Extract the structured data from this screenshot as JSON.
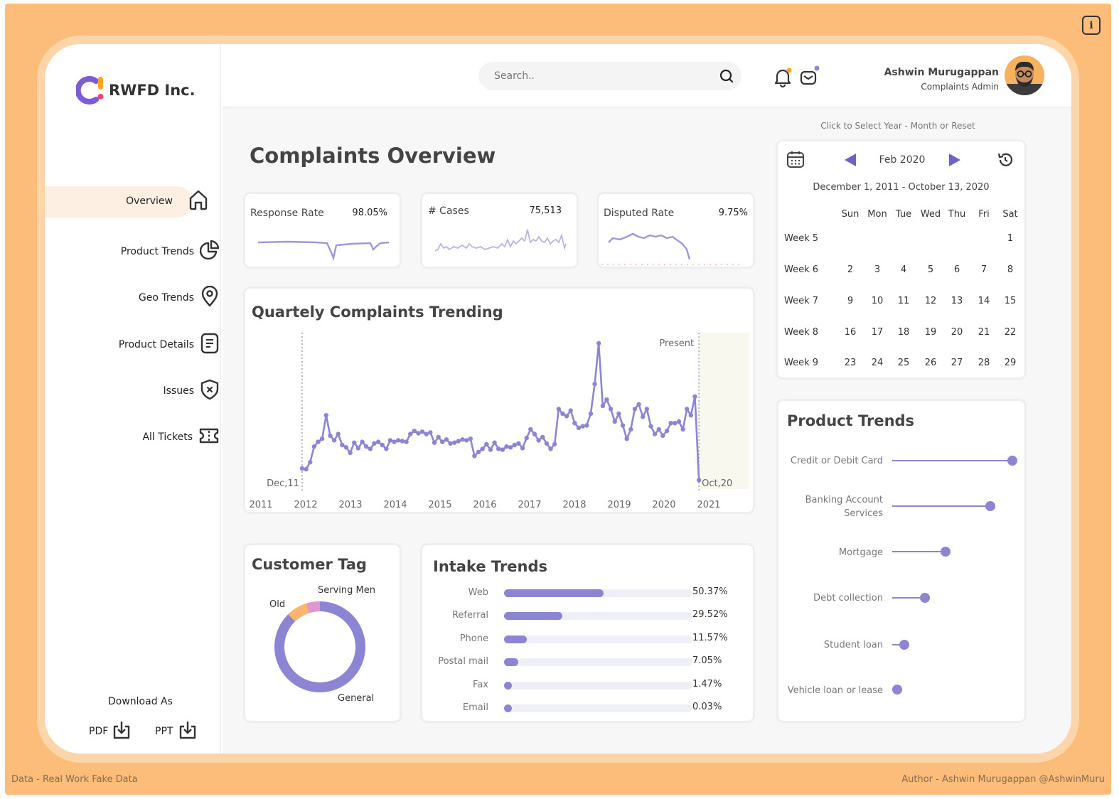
{
  "app": {
    "brand": "RWFD Inc.",
    "info_icon": "info-icon",
    "footer_left": "Data - Real Work Fake Data",
    "footer_right": "Author - Ashwin Murugappan @AshwinMuru"
  },
  "colors": {
    "page_bg": "#fcbd7b",
    "accent": "#8b85d4",
    "accent_dark": "#6c62c9",
    "active_nav": "#fdf0e3"
  },
  "sidebar": {
    "items": [
      {
        "label": "Overview",
        "icon": "home-icon"
      },
      {
        "label": "Product Trends",
        "icon": "pie-chart-icon"
      },
      {
        "label": "Geo Trends",
        "icon": "map-pin-icon"
      },
      {
        "label": "Product Details",
        "icon": "document-icon"
      },
      {
        "label": "Issues",
        "icon": "shield-x-icon"
      },
      {
        "label": "All Tickets",
        "icon": "ticket-icon"
      }
    ],
    "download_label": "Download As",
    "pdf_label": "PDF",
    "ppt_label": "PPT"
  },
  "header": {
    "search_placeholder": "Search..",
    "user_name": "Ashwin Murugappan",
    "user_role": "Complaints Admin"
  },
  "main": {
    "title": "Complaints Overview",
    "kpis": [
      {
        "label": "Response Rate",
        "value": "98.05%"
      },
      {
        "label": "# Cases",
        "value": "75,513"
      },
      {
        "label": "Disputed Rate",
        "value": "9.75%"
      }
    ],
    "customer_tag": {
      "title": "Customer Tag",
      "labels": {
        "old": "Old",
        "serving": "Serving Men",
        "general": "General"
      }
    },
    "intake": {
      "title": "Intake Trends",
      "rows": [
        {
          "label": "Web",
          "value": 50.37,
          "display": "50.37%"
        },
        {
          "label": "Referral",
          "value": 29.52,
          "display": "29.52%"
        },
        {
          "label": "Phone",
          "value": 11.57,
          "display": "11.57%"
        },
        {
          "label": "Postal mail",
          "value": 7.05,
          "display": "7.05%"
        },
        {
          "label": "Fax",
          "value": 1.47,
          "display": "1.47%"
        },
        {
          "label": "Email",
          "value": 0.03,
          "display": "0.03%"
        }
      ]
    }
  },
  "calendar": {
    "hint": "Click to Select Year - Month or Reset",
    "month": "Feb 2020",
    "range": "December 1, 2011 - October 13, 2020",
    "days": [
      "Sun",
      "Mon",
      "Tue",
      "Wed",
      "Thu",
      "Fri",
      "Sat"
    ],
    "weeks": [
      {
        "label": "Week 5",
        "cells": [
          "",
          "",
          "",
          "",
          "",
          "",
          "1"
        ]
      },
      {
        "label": "Week 6",
        "cells": [
          "2",
          "3",
          "4",
          "5",
          "6",
          "7",
          "8"
        ]
      },
      {
        "label": "Week 7",
        "cells": [
          "9",
          "10",
          "11",
          "12",
          "13",
          "14",
          "15"
        ]
      },
      {
        "label": "Week 8",
        "cells": [
          "16",
          "17",
          "18",
          "19",
          "20",
          "21",
          "22"
        ]
      },
      {
        "label": "Week 9",
        "cells": [
          "23",
          "24",
          "25",
          "26",
          "27",
          "28",
          "29"
        ]
      }
    ]
  },
  "product_trends": {
    "title": "Product Trends",
    "items": [
      {
        "label": "Credit or Debit Card",
        "value": 1.0
      },
      {
        "label": "Banking Account Services",
        "value": 0.81
      },
      {
        "label": "Mortgage",
        "value": 0.42
      },
      {
        "label": "Debt collection",
        "value": 0.24
      },
      {
        "label": "Student loan",
        "value": 0.06
      },
      {
        "label": "Vehicle loan or lease",
        "value": 0.0
      }
    ]
  },
  "chart_data": {
    "type": "line",
    "title": "Quartely Complaints Trending",
    "x_ticks": [
      "2011",
      "2012",
      "2013",
      "2014",
      "2015",
      "2016",
      "2017",
      "2018",
      "2019",
      "2020",
      "2021"
    ],
    "xlim": [
      2011,
      2021
    ],
    "annotations": {
      "start": "Dec,11",
      "end": "Oct,20",
      "present": "Present"
    },
    "start_x": 2011.92,
    "end_x": 2020.78,
    "grid": false,
    "series": [
      {
        "values": [
          30,
          29,
          38,
          58,
          64,
          68,
          98,
          72,
          66,
          74,
          60,
          57,
          50,
          63,
          56,
          64,
          58,
          55,
          62,
          64,
          60,
          55,
          66,
          64,
          66,
          65,
          64,
          74,
          78,
          75,
          77,
          74,
          76,
          63,
          70,
          64,
          67,
          62,
          63,
          65,
          67,
          66,
          68,
          46,
          51,
          55,
          61,
          54,
          63,
          55,
          54,
          58,
          57,
          60,
          62,
          56,
          69,
          80,
          74,
          66,
          70,
          62,
          55,
          61,
          106,
          100,
          97,
          104,
          88,
          82,
          84,
          85,
          100,
          138,
          190,
          110,
          118,
          106,
          90,
          100,
          85,
          68,
          80,
          106,
          112,
          96,
          106,
          84,
          74,
          80,
          72,
          78,
          88,
          88,
          90,
          80,
          106,
          98,
          122,
          15
        ],
        "ylim": [
          0,
          200
        ]
      }
    ]
  }
}
